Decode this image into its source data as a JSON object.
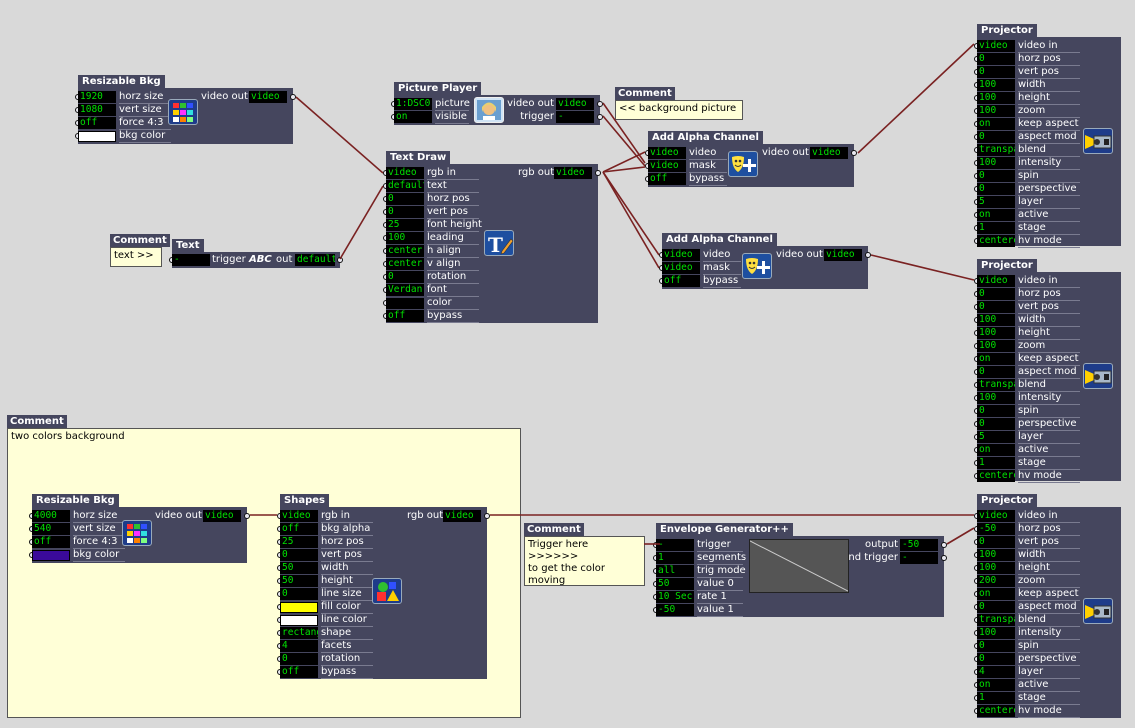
{
  "colors": {
    "wire": "#7a2222",
    "actor_bg": "#45465e",
    "value_text": "#00e000",
    "comment_bg": "#ffffd7",
    "canvas": "#d9d9d9"
  },
  "resizable_bkg_1": {
    "title": "Resizable Bkg",
    "out_label": "video out",
    "out_value": "video",
    "rows": [
      {
        "value": "1920",
        "label": "horz size"
      },
      {
        "value": "1080",
        "label": "vert size"
      },
      {
        "value": "off",
        "label": "force 4:3"
      },
      {
        "value": "",
        "label": "bkg color",
        "swatch": "#ffffff"
      }
    ],
    "icon": "color-grid-icon"
  },
  "picture_player": {
    "title": "Picture Player",
    "rows": [
      {
        "value": "1:DSC0",
        "label": "picture"
      },
      {
        "value": "on",
        "label": "visible"
      }
    ],
    "outs": [
      {
        "label": "video out",
        "value": "video"
      },
      {
        "label": "trigger",
        "value": "-"
      }
    ],
    "icon": "portrait-icon"
  },
  "comment_bg_picture": {
    "title": "Comment",
    "text": "<< background picture"
  },
  "text_draw": {
    "title": "Text Draw",
    "out_label": "rgb out",
    "out_value": "video",
    "rows": [
      {
        "value": "video",
        "label": "rgb in"
      },
      {
        "value": "defaulto",
        "label": "text"
      },
      {
        "value": "0",
        "label": "horz pos"
      },
      {
        "value": "0",
        "label": "vert pos"
      },
      {
        "value": "25",
        "label": "font height"
      },
      {
        "value": "100",
        "label": "leading"
      },
      {
        "value": "center",
        "label": "h align"
      },
      {
        "value": "center",
        "label": "v align"
      },
      {
        "value": "0",
        "label": "rotation"
      },
      {
        "value": "Verdan",
        "label": "font"
      },
      {
        "value": "",
        "label": "color",
        "swatch": "#000000"
      },
      {
        "value": "off",
        "label": "bypass"
      }
    ],
    "icon": "text-pencil-icon"
  },
  "comment_text": {
    "title": "Comment",
    "text": "text >>"
  },
  "text_actor": {
    "title": "Text",
    "in_value": "-",
    "trigger_label": "trigger",
    "abc": "ABC",
    "out_label": "out",
    "out_value": "defaulto"
  },
  "alpha_1": {
    "title": "Add Alpha Channel",
    "out_label": "video out",
    "out_value": "video",
    "rows": [
      {
        "value": "video",
        "label": "video"
      },
      {
        "value": "video",
        "label": "mask"
      },
      {
        "value": "off",
        "label": "bypass"
      }
    ],
    "icon": "masks-plus-icon"
  },
  "alpha_2": {
    "title": "Add Alpha Channel",
    "out_label": "video out",
    "out_value": "video",
    "rows": [
      {
        "value": "video",
        "label": "video"
      },
      {
        "value": "video",
        "label": "mask"
      },
      {
        "value": "off",
        "label": "bypass"
      }
    ],
    "icon": "masks-plus-icon"
  },
  "projector_1": {
    "title": "Projector",
    "rows": [
      {
        "value": "video",
        "label": "video in"
      },
      {
        "value": "0",
        "label": "horz pos"
      },
      {
        "value": "0",
        "label": "vert pos"
      },
      {
        "value": "100",
        "label": "width"
      },
      {
        "value": "100",
        "label": "height"
      },
      {
        "value": "100",
        "label": "zoom"
      },
      {
        "value": "on",
        "label": "keep aspect"
      },
      {
        "value": "0",
        "label": "aspect mod"
      },
      {
        "value": "transpa",
        "label": "blend"
      },
      {
        "value": "100",
        "label": "intensity"
      },
      {
        "value": "0",
        "label": "spin"
      },
      {
        "value": "0",
        "label": "perspective"
      },
      {
        "value": "5",
        "label": "layer"
      },
      {
        "value": "on",
        "label": "active"
      },
      {
        "value": "1",
        "label": "stage"
      },
      {
        "value": "centere",
        "label": "hv mode"
      }
    ],
    "icon": "projector-icon"
  },
  "projector_2": {
    "title": "Projector",
    "rows": [
      {
        "value": "video",
        "label": "video in"
      },
      {
        "value": "0",
        "label": "horz pos"
      },
      {
        "value": "0",
        "label": "vert pos"
      },
      {
        "value": "100",
        "label": "width"
      },
      {
        "value": "100",
        "label": "height"
      },
      {
        "value": "100",
        "label": "zoom"
      },
      {
        "value": "on",
        "label": "keep aspect"
      },
      {
        "value": "0",
        "label": "aspect mod"
      },
      {
        "value": "transpa",
        "label": "blend"
      },
      {
        "value": "100",
        "label": "intensity"
      },
      {
        "value": "0",
        "label": "spin"
      },
      {
        "value": "0",
        "label": "perspective"
      },
      {
        "value": "5",
        "label": "layer"
      },
      {
        "value": "on",
        "label": "active"
      },
      {
        "value": "1",
        "label": "stage"
      },
      {
        "value": "centere",
        "label": "hv mode"
      }
    ],
    "icon": "projector-icon"
  },
  "projector_3": {
    "title": "Projector",
    "rows": [
      {
        "value": "video",
        "label": "video in"
      },
      {
        "value": "-50",
        "label": "horz pos"
      },
      {
        "value": "0",
        "label": "vert pos"
      },
      {
        "value": "100",
        "label": "width"
      },
      {
        "value": "100",
        "label": "height"
      },
      {
        "value": "200",
        "label": "zoom"
      },
      {
        "value": "on",
        "label": "keep aspect"
      },
      {
        "value": "0",
        "label": "aspect mod"
      },
      {
        "value": "transpa",
        "label": "blend"
      },
      {
        "value": "100",
        "label": "intensity"
      },
      {
        "value": "0",
        "label": "spin"
      },
      {
        "value": "0",
        "label": "perspective"
      },
      {
        "value": "4",
        "label": "layer"
      },
      {
        "value": "on",
        "label": "active"
      },
      {
        "value": "1",
        "label": "stage"
      },
      {
        "value": "centere",
        "label": "hv mode"
      }
    ],
    "icon": "projector-icon"
  },
  "comment_two_colors": {
    "title": "Comment",
    "text": "two colors background"
  },
  "resizable_bkg_2": {
    "title": "Resizable Bkg",
    "out_label": "video out",
    "out_value": "video",
    "rows": [
      {
        "value": "4000",
        "label": "horz size"
      },
      {
        "value": "540",
        "label": "vert size"
      },
      {
        "value": "off",
        "label": "force 4:3"
      },
      {
        "value": "",
        "label": "bkg color",
        "swatch": "#3a0a9a"
      }
    ],
    "icon": "color-grid-icon"
  },
  "shapes": {
    "title": "Shapes",
    "out_label": "rgb out",
    "out_value": "video",
    "rows": [
      {
        "value": "video",
        "label": "rgb in"
      },
      {
        "value": "off",
        "label": "bkg alpha"
      },
      {
        "value": "25",
        "label": "horz pos"
      },
      {
        "value": "0",
        "label": "vert pos"
      },
      {
        "value": "50",
        "label": "width"
      },
      {
        "value": "50",
        "label": "height"
      },
      {
        "value": "0",
        "label": "line size"
      },
      {
        "value": "",
        "label": "fill color",
        "swatch": "#ffff00"
      },
      {
        "value": "",
        "label": "line color",
        "swatch": "#ffffff"
      },
      {
        "value": "rectang",
        "label": "shape"
      },
      {
        "value": "4",
        "label": "facets"
      },
      {
        "value": "0",
        "label": "rotation"
      },
      {
        "value": "off",
        "label": "bypass"
      }
    ],
    "icon": "shapes-icon"
  },
  "comment_trigger": {
    "title": "Comment",
    "text": "Trigger here >>>>>>\nto get the color moving"
  },
  "envelope": {
    "title": "Envelope Generator++",
    "rows": [
      {
        "value": "-",
        "label": "trigger"
      },
      {
        "value": "1",
        "label": "segments"
      },
      {
        "value": "all",
        "label": "trig mode"
      },
      {
        "value": "50",
        "label": "value 0"
      },
      {
        "value": "10 Sec",
        "label": "rate 1"
      },
      {
        "value": "-50",
        "label": "value 1"
      }
    ],
    "outs": [
      {
        "label": "output",
        "value": "-50"
      },
      {
        "label": "end trigger",
        "value": "-"
      }
    ]
  }
}
